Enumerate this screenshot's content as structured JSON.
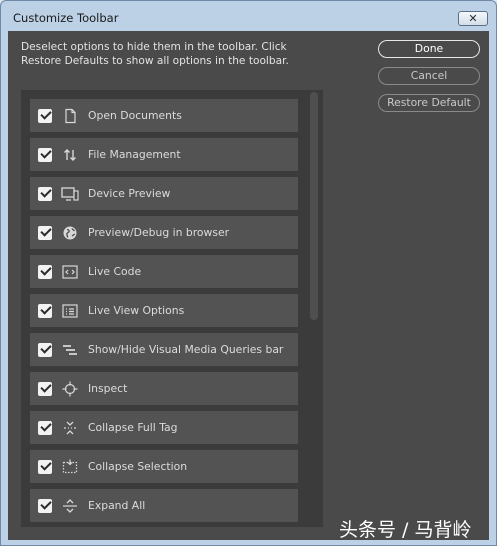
{
  "window": {
    "title": "Customize Toolbar",
    "close_label": "✕"
  },
  "instructions": "Deselect options to hide them in the toolbar. Click Restore Defaults to show all options in the toolbar.",
  "buttons": {
    "done": "Done",
    "cancel": "Cancel",
    "restore": "Restore Default"
  },
  "items": [
    {
      "label": "Open Documents",
      "icon": "document-icon",
      "checked": true
    },
    {
      "label": "File Management",
      "icon": "file-transfer-icon",
      "checked": true
    },
    {
      "label": "Device Preview",
      "icon": "device-preview-icon",
      "checked": true
    },
    {
      "label": "Preview/Debug in browser",
      "icon": "globe-icon",
      "checked": true
    },
    {
      "label": "Live Code",
      "icon": "code-icon",
      "checked": true
    },
    {
      "label": "Live View Options",
      "icon": "list-options-icon",
      "checked": true
    },
    {
      "label": "Show/Hide Visual Media Queries bar",
      "icon": "media-queries-icon",
      "checked": true
    },
    {
      "label": "Inspect",
      "icon": "crosshair-icon",
      "checked": true
    },
    {
      "label": "Collapse Full Tag",
      "icon": "collapse-full-tag-icon",
      "checked": true
    },
    {
      "label": "Collapse Selection",
      "icon": "collapse-selection-icon",
      "checked": true
    },
    {
      "label": "Expand All",
      "icon": "expand-all-icon",
      "checked": true
    }
  ],
  "watermark": "头条号 / 马背岭"
}
